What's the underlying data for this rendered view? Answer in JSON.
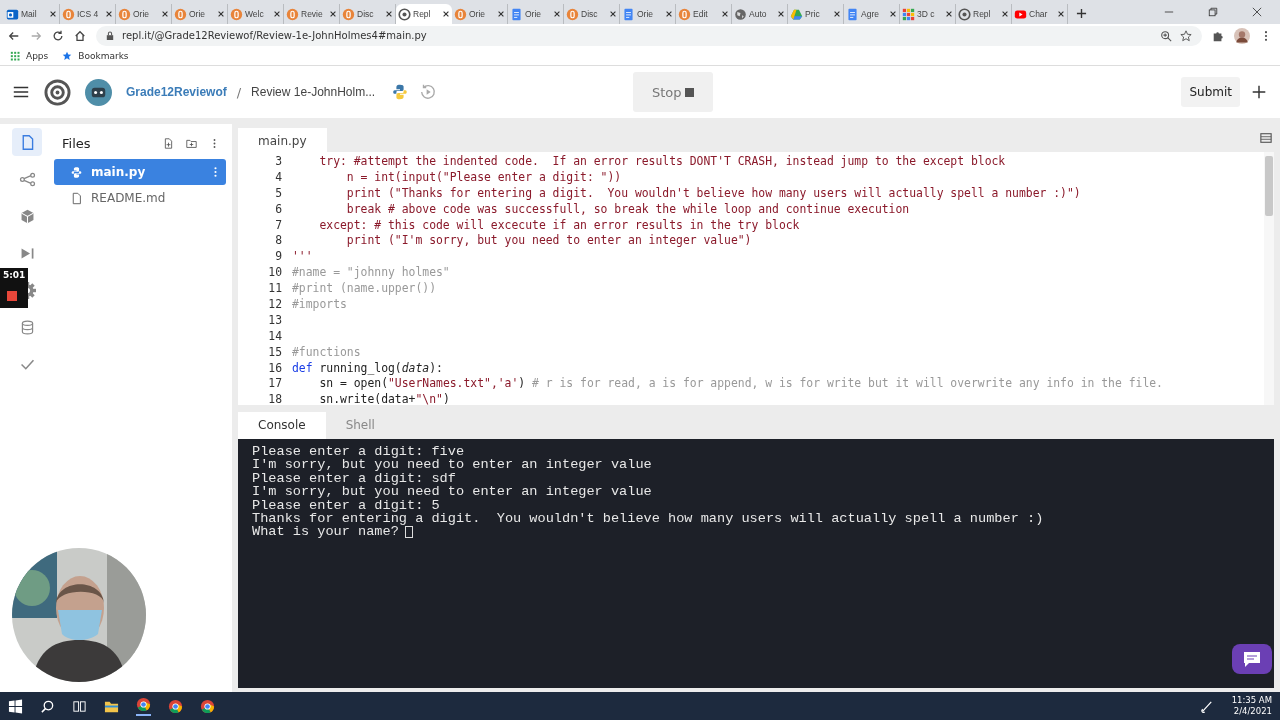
{
  "browser": {
    "tabs": [
      {
        "label": "Mail",
        "kind": "outlook",
        "selected": false
      },
      {
        "label": "ICS 4",
        "kind": "b",
        "selected": false
      },
      {
        "label": "Orie",
        "kind": "b",
        "selected": false
      },
      {
        "label": "Orie",
        "kind": "b",
        "selected": false
      },
      {
        "label": "Welc",
        "kind": "b",
        "selected": false
      },
      {
        "label": "Revie",
        "kind": "b",
        "selected": false
      },
      {
        "label": "Disc",
        "kind": "b",
        "selected": false
      },
      {
        "label": "Repl",
        "kind": "repl",
        "selected": true
      },
      {
        "label": "Orie",
        "kind": "b",
        "selected": false
      },
      {
        "label": "Orie",
        "kind": "doc",
        "selected": false
      },
      {
        "label": "Disc",
        "kind": "b",
        "selected": false
      },
      {
        "label": "Orie",
        "kind": "doc",
        "selected": false
      },
      {
        "label": "Edit",
        "kind": "b",
        "selected": false
      },
      {
        "label": "Auto",
        "kind": "globe",
        "selected": false
      },
      {
        "label": "Pric",
        "kind": "drive",
        "selected": false
      },
      {
        "label": "Agre",
        "kind": "doc",
        "selected": false
      },
      {
        "label": "3D c",
        "kind": "grid",
        "selected": false
      },
      {
        "label": "Repl",
        "kind": "repl",
        "selected": false
      },
      {
        "label": "Char",
        "kind": "youtube",
        "selected": false
      }
    ],
    "url": "repl.it/@Grade12Reviewof/Review-1e-JohnHolmes4#main.py",
    "bookmarks": [
      {
        "label": "Apps",
        "kind": "apps"
      },
      {
        "label": "Bookmarks",
        "kind": "star"
      }
    ]
  },
  "header": {
    "user": "Grade12Reviewof",
    "separator": "/",
    "project": "Review 1e-JohnHolm...",
    "run_button": "Stop",
    "submit_button": "Submit"
  },
  "sidebar": {
    "items": [
      {
        "kind": "file",
        "selected": true
      },
      {
        "kind": "share",
        "selected": false
      },
      {
        "kind": "cube",
        "selected": false
      },
      {
        "kind": "debug",
        "selected": false
      },
      {
        "kind": "gear",
        "selected": false
      },
      {
        "kind": "database",
        "selected": false
      },
      {
        "kind": "check",
        "selected": false
      }
    ]
  },
  "files": {
    "title": "Files",
    "items": [
      {
        "name": "main.py",
        "kind": "python",
        "selected": true
      },
      {
        "name": "README.md",
        "kind": "file",
        "selected": false
      }
    ]
  },
  "editor": {
    "tab": "main.py",
    "lines": [
      {
        "number": "3",
        "segments": [
          {
            "kind": "string",
            "text": "    try: #attempt the indented code.  If an error results DONT'T CRASH, instead jump to the except block"
          }
        ]
      },
      {
        "number": "4",
        "segments": [
          {
            "kind": "string",
            "text": "        n = int(input(\"Please enter a digit: \"))"
          }
        ]
      },
      {
        "number": "5",
        "segments": [
          {
            "kind": "string",
            "text": "        print (\"Thanks for entering a digit.  You wouldn't believe how many users will actually spell a number :)\")"
          }
        ]
      },
      {
        "number": "6",
        "segments": [
          {
            "kind": "string",
            "text": "        break # above code was successfull, so break the while loop and continue execution"
          }
        ]
      },
      {
        "number": "7",
        "segments": [
          {
            "kind": "string",
            "text": "    except: # this code will excecute if an error results in the try block"
          }
        ]
      },
      {
        "number": "8",
        "segments": [
          {
            "kind": "string",
            "text": "        print (\"I'm sorry, but you need to enter an integer value\")"
          }
        ]
      },
      {
        "number": "9",
        "segments": [
          {
            "kind": "string",
            "text": "'''"
          }
        ]
      },
      {
        "number": "10",
        "segments": [
          {
            "kind": "comment",
            "text": "#name = \"johnny holmes\""
          }
        ]
      },
      {
        "number": "11",
        "segments": [
          {
            "kind": "comment",
            "text": "#print (name.upper())"
          }
        ]
      },
      {
        "number": "12",
        "segments": [
          {
            "kind": "comment",
            "text": "#imports"
          }
        ]
      },
      {
        "number": "13"
      },
      {
        "number": "14"
      },
      {
        "number": "15",
        "segments": [
          {
            "kind": "comment",
            "text": "#functions"
          }
        ]
      },
      {
        "number": "16",
        "segments": [
          {
            "kind": "keyword",
            "text": "def"
          },
          {
            "kind": "plain",
            "text": " running_log("
          },
          {
            "kind": "param",
            "text": "data"
          },
          {
            "kind": "plain",
            "text": "):"
          }
        ]
      },
      {
        "number": "17",
        "segments": [
          {
            "kind": "plain",
            "text": "    sn = open("
          },
          {
            "kind": "string",
            "text": "\"UserNames.txt\",'a'"
          },
          {
            "kind": "plain",
            "text": ") "
          },
          {
            "kind": "comment",
            "text": "# r is for read, a is for append, w is for write but it will overwrite any info in the file."
          }
        ]
      },
      {
        "number": "18",
        "segments": [
          {
            "kind": "plain",
            "text": "    sn.write(data+"
          },
          {
            "kind": "string",
            "text": "\"\\n\""
          },
          {
            "kind": "plain",
            "text": ")"
          }
        ]
      }
    ]
  },
  "console": {
    "tabs": [
      {
        "label": "Console",
        "selected": true
      },
      {
        "label": "Shell",
        "selected": false
      }
    ],
    "lines": [
      "Please enter a digit: five",
      "I'm sorry, but you need to enter an integer value",
      "Please enter a digit: sdf",
      "I'm sorry, but you need to enter an integer value",
      "Please enter a digit: 5",
      "Thanks for entering a digit.  You wouldn't believe how many users will actually spell a number :)",
      "What is your name?"
    ]
  },
  "recording": {
    "time": "5:01"
  },
  "taskbar": {
    "time": "11:35 AM",
    "date": "2/4/2021"
  }
}
